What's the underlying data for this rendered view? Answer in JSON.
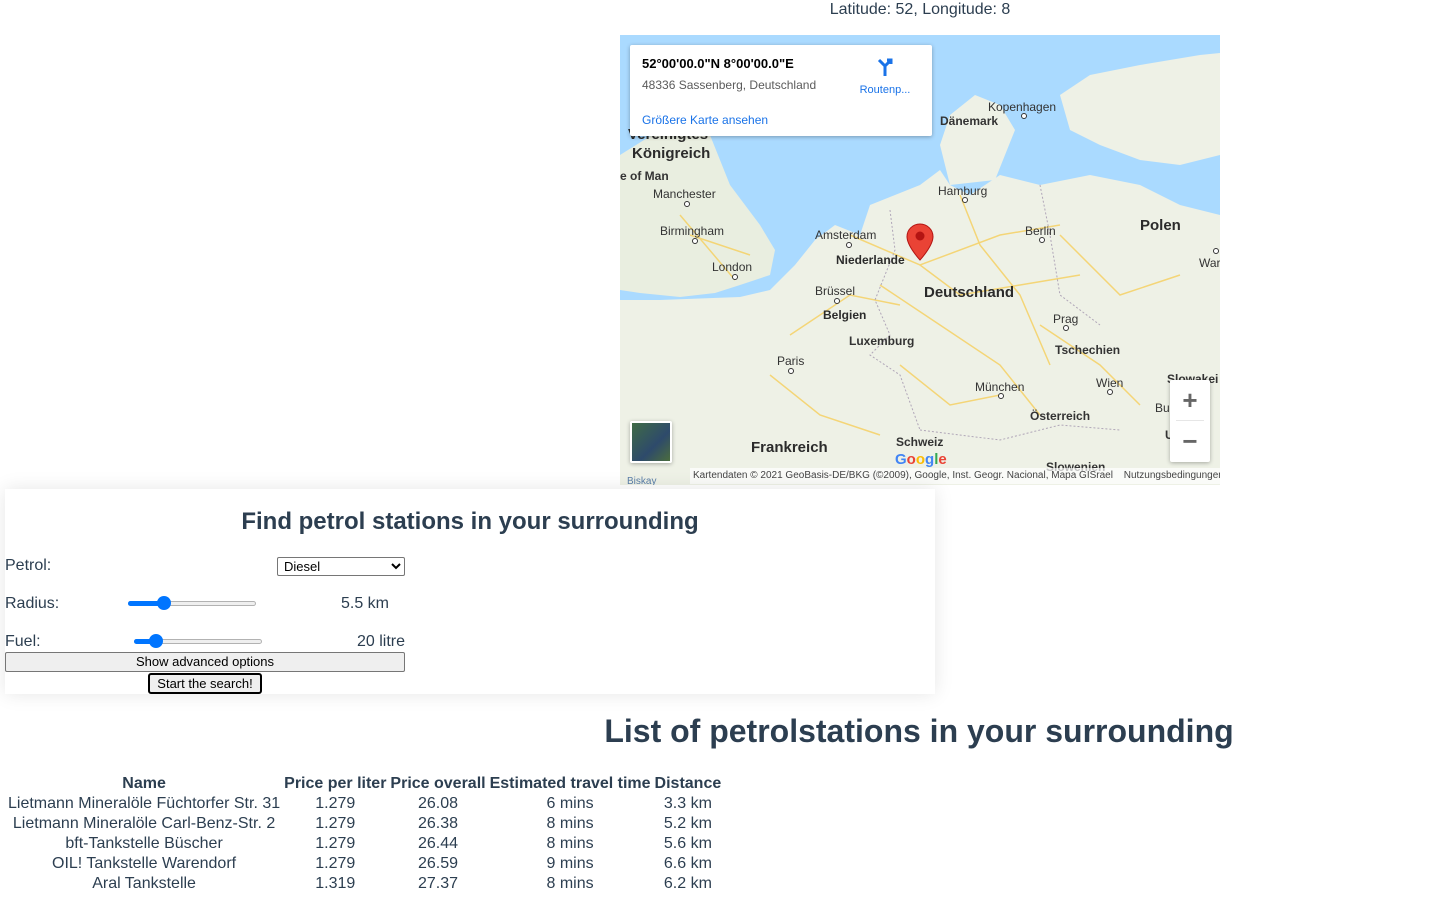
{
  "header": {
    "coords_text": "Latitude: 52, Longitude: 8"
  },
  "map": {
    "info_card": {
      "place": "52°00'00.0\"N 8°00'00.0\"E",
      "address": "48336 Sassenberg, Deutschland",
      "bigger_map_link": "Größere Karte ansehen",
      "route_label": "Routenp..."
    },
    "labels": {
      "vereinigtes": "Vereinigtes",
      "koenigreich": "Königreich",
      "isle_of_man": "e of Man",
      "manchester": "Manchester",
      "birmingham": "Birmingham",
      "london": "London",
      "amsterdam": "Amsterdam",
      "niederlande": "Niederlande",
      "bruessel": "Brüssel",
      "belgien": "Belgien",
      "luxemburg": "Luxemburg",
      "paris": "Paris",
      "frankreich": "Frankreich",
      "deutschland": "Deutschland",
      "hamburg": "Hamburg",
      "berlin": "Berlin",
      "polen": "Polen",
      "warsc": "Warsc",
      "kopenhagen": "Kopenhagen",
      "daenemark": "Dänemark",
      "prag": "Prag",
      "tschechien": "Tschechien",
      "muenchen": "München",
      "wien": "Wien",
      "oesterreich": "Österreich",
      "slowakei": "Slowakei",
      "buda": "Buda",
      "schweiz": "Schweiz",
      "slowenien": "Slowenien",
      "u": "U",
      "biskay": "Biskay"
    },
    "google_logo": "Google",
    "attribution": "Kartendaten © 2021 GeoBasis-DE/BKG (©2009), Google, Inst. Geogr. Nacional, Mapa GISrael",
    "terms": "Nutzungsbedingungen",
    "zoom_in": "+",
    "zoom_out": "−"
  },
  "form": {
    "title": "Find petrol stations in your surrounding",
    "petrol_label": "Petrol:",
    "petrol_selected": "Diesel",
    "radius_label": "Radius:",
    "radius_value_text": "5.5 km",
    "radius_fraction": 0.28,
    "fuel_label": "Fuel:",
    "fuel_value_text": "20 litre",
    "fuel_fraction": 0.17,
    "advanced_button": "Show advanced options",
    "start_button": "Start the search!"
  },
  "results": {
    "title": "List of petrolstations in your surrounding",
    "columns": [
      "Name",
      "Price per liter",
      "Price overall",
      "Estimated travel time",
      "Distance"
    ],
    "rows": [
      [
        "Lietmann Mineralöle Füchtorfer Str. 31",
        "1.279",
        "26.08",
        "6 mins",
        "3.3 km"
      ],
      [
        "Lietmann Mineralöle Carl-Benz-Str. 2",
        "1.279",
        "26.38",
        "8 mins",
        "5.2 km"
      ],
      [
        "bft-Tankstelle Büscher",
        "1.279",
        "26.44",
        "8 mins",
        "5.6 km"
      ],
      [
        "OIL! Tankstelle Warendorf",
        "1.279",
        "26.59",
        "9 mins",
        "6.6 km"
      ],
      [
        "Aral Tankstelle",
        "1.319",
        "27.37",
        "8 mins",
        "6.2 km"
      ]
    ]
  }
}
